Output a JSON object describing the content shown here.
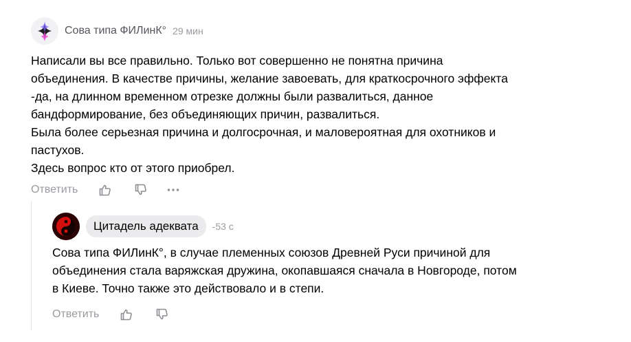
{
  "comments": [
    {
      "author": "Сова типа ФИЛинК°",
      "time": "29 мин",
      "text": "Написали вы все правильно. Только вот совершенно не понятна причина\nобъединения. В качестве причины, желание завоевать, для краткосрочного эффекта\n-да, на длинном временном отрезке должны были развалиться, данное\nбандформирование, без объединяющих причин, развалиться.\nБыла более серьезная причина и долгосрочная, и маловероятная для охотников и\nпастухов.\nЗдесь вопрос кто от этого приобрел.",
      "reply_label": "Ответить",
      "icons": [
        "thumb-up-icon",
        "thumb-down-icon",
        "more-icon"
      ]
    },
    {
      "author": "Цитадель адеквата",
      "time": "-53 с",
      "text": "Сова типа ФИЛинК°, в случае племенных союзов Древней Руси причиной для\nобъединения стала варяжская дружина, окопавшаяся сначала в Новгороде, потом\nв Киеве. Точно также это действовало и в степи.",
      "reply_label": "Ответить",
      "icons": [
        "thumb-up-icon",
        "thumb-down-icon"
      ]
    }
  ],
  "colors": {
    "muted": "#9a9aa0",
    "author": "#55555b",
    "pill": "#ebebee",
    "text": "#000000"
  }
}
